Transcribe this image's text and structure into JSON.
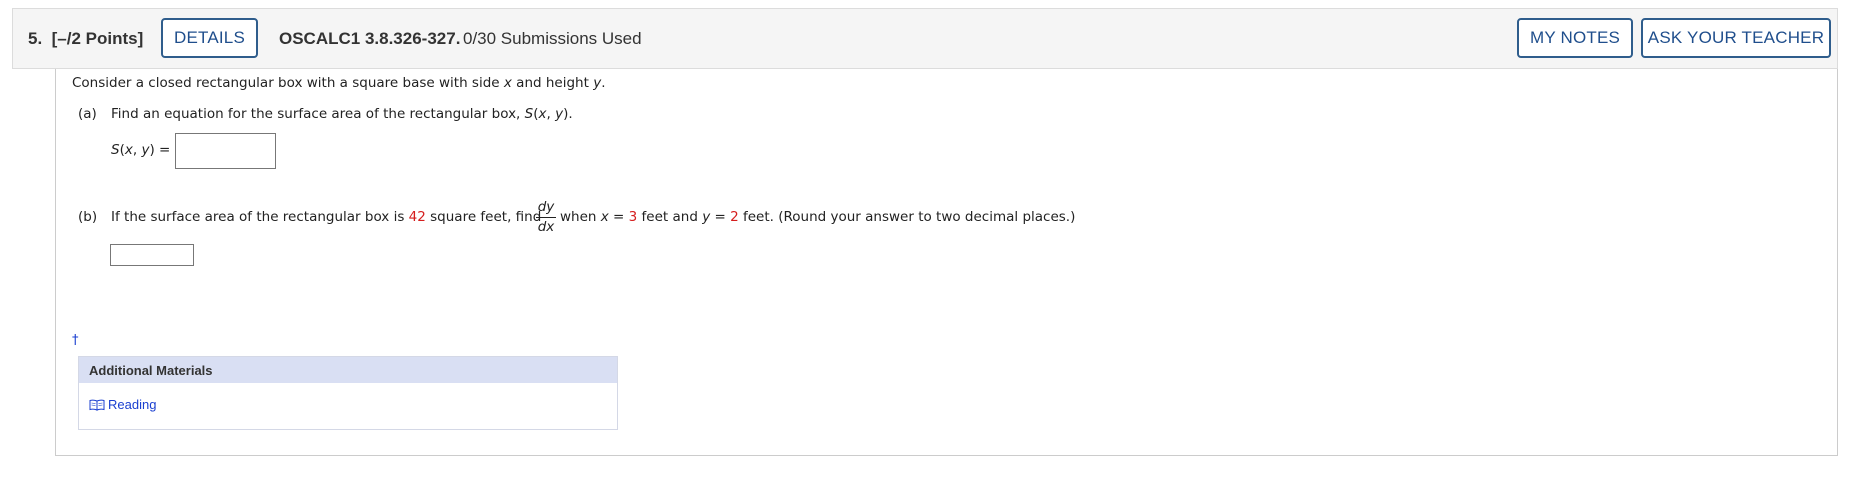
{
  "header": {
    "question_number": "5.",
    "points": "[–/2 Points]",
    "details_label": "DETAILS",
    "code": "OSCALC1 3.8.326-327.",
    "submissions": "0/30 Submissions Used",
    "my_notes_label": "MY NOTES",
    "ask_teacher_label": "ASK YOUR TEACHER"
  },
  "problem": {
    "intro": {
      "t1": "Consider a closed rectangular box with a square base with side ",
      "x": "x",
      "t2": " and height ",
      "y": "y",
      "t3": "."
    },
    "part_a": {
      "label": "(a)",
      "t1": "Find an equation for the surface area of the rectangular box, ",
      "fn": "S",
      "t2": "(",
      "x": "x",
      "t3": ", ",
      "y": "y",
      "t4": ").",
      "answer_prefix": {
        "fn": "S",
        "p1": "(",
        "x": "x",
        "p2": ", ",
        "y": "y",
        "p3": ") ="
      },
      "answer_value": ""
    },
    "part_b": {
      "label": "(b)",
      "t1": "If the surface area of the rectangular box is ",
      "area": "42",
      "t2": " square feet, find ",
      "frac_num": "dy",
      "frac_den": "dx",
      "t3": " when ",
      "x": "x",
      "t4": " = ",
      "x_val": "3",
      "t5": " feet and ",
      "y": "y",
      "t6": " = ",
      "y_val": "2",
      "t7": " feet. (Round your answer to two decimal places.)",
      "answer_value": ""
    }
  },
  "dagger": "†",
  "additional_materials": {
    "title": "Additional Materials",
    "reading_label": "Reading",
    "reading_icon": "book-icon"
  },
  "colors": {
    "given_value": "#d51e1e",
    "button_border": "#2f5d8c",
    "link": "#1a3fd0",
    "materials_header": "#d9dff3"
  }
}
